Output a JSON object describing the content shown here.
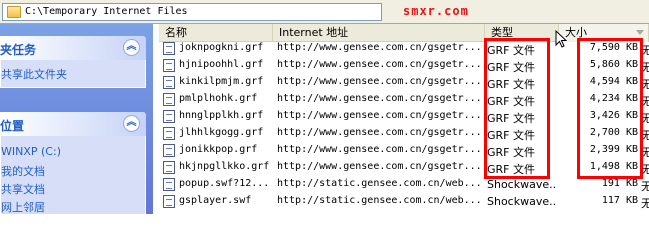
{
  "address_bar": {
    "path": "C:\\Temporary Internet Files"
  },
  "watermark": "smxr.com",
  "task_pane": {
    "file_tasks": {
      "title": "夹任务",
      "items": [
        "共享此文件夹"
      ]
    },
    "other_places": {
      "title": "位置",
      "items": [
        "WINXP (C:)",
        "我的文档",
        "共享文档",
        "网上邻居"
      ]
    }
  },
  "columns": {
    "name": "名称",
    "address": "Internet 地址",
    "type": "类型",
    "size": "大小"
  },
  "rows": [
    {
      "name": "joknpogkni.grf",
      "address": "http://www.gensee.com.cn/gsgetr...",
      "type": "GRF 文件",
      "size": "7,590 KB",
      "more": "无"
    },
    {
      "name": "hjnipoohhl.grf",
      "address": "http://www.gensee.com.cn/gsgetr...",
      "type": "GRF 文件",
      "size": "5,860 KB",
      "more": "无"
    },
    {
      "name": "kinkilpmjm.grf",
      "address": "http://www.gensee.com.cn/gsgetr...",
      "type": "GRF 文件",
      "size": "4,594 KB",
      "more": "无"
    },
    {
      "name": "pmlplhohk.grf",
      "address": "http://www.gensee.com.cn/gsgetr...",
      "type": "GRF 文件",
      "size": "4,234 KB",
      "more": "无"
    },
    {
      "name": "hnnglpplkh.grf",
      "address": "http://www.gensee.com.cn/gsgetr...",
      "type": "GRF 文件",
      "size": "3,426 KB",
      "more": "无"
    },
    {
      "name": "jlhhlkgogg.grf",
      "address": "http://www.gensee.com.cn/gsgetr...",
      "type": "GRF 文件",
      "size": "2,700 KB",
      "more": "无"
    },
    {
      "name": "jonikkpop.grf",
      "address": "http://www.gensee.com.cn/gsgetr...",
      "type": "GRF 文件",
      "size": "2,399 KB",
      "more": "无"
    },
    {
      "name": "hkjnpgllkko.grf",
      "address": "http://www.gensee.com.cn/gsgetr...",
      "type": "GRF 文件",
      "size": "1,498 KB",
      "more": "无"
    },
    {
      "name": "popup.swf?12...",
      "address": "http://static.gensee.com.cn/web...",
      "type": "Shockwave...",
      "size": "191 KB",
      "more": "无"
    },
    {
      "name": "gsplayer.swf",
      "address": "http://static.gensee.com.cn/web...",
      "type": "Shockwave...",
      "size": "117 KB",
      "more": "无"
    }
  ],
  "colors": {
    "highlight": "#ff0000",
    "watermark": "#ee1111",
    "pane": "#6b8ee0",
    "link": "#215dc6"
  }
}
